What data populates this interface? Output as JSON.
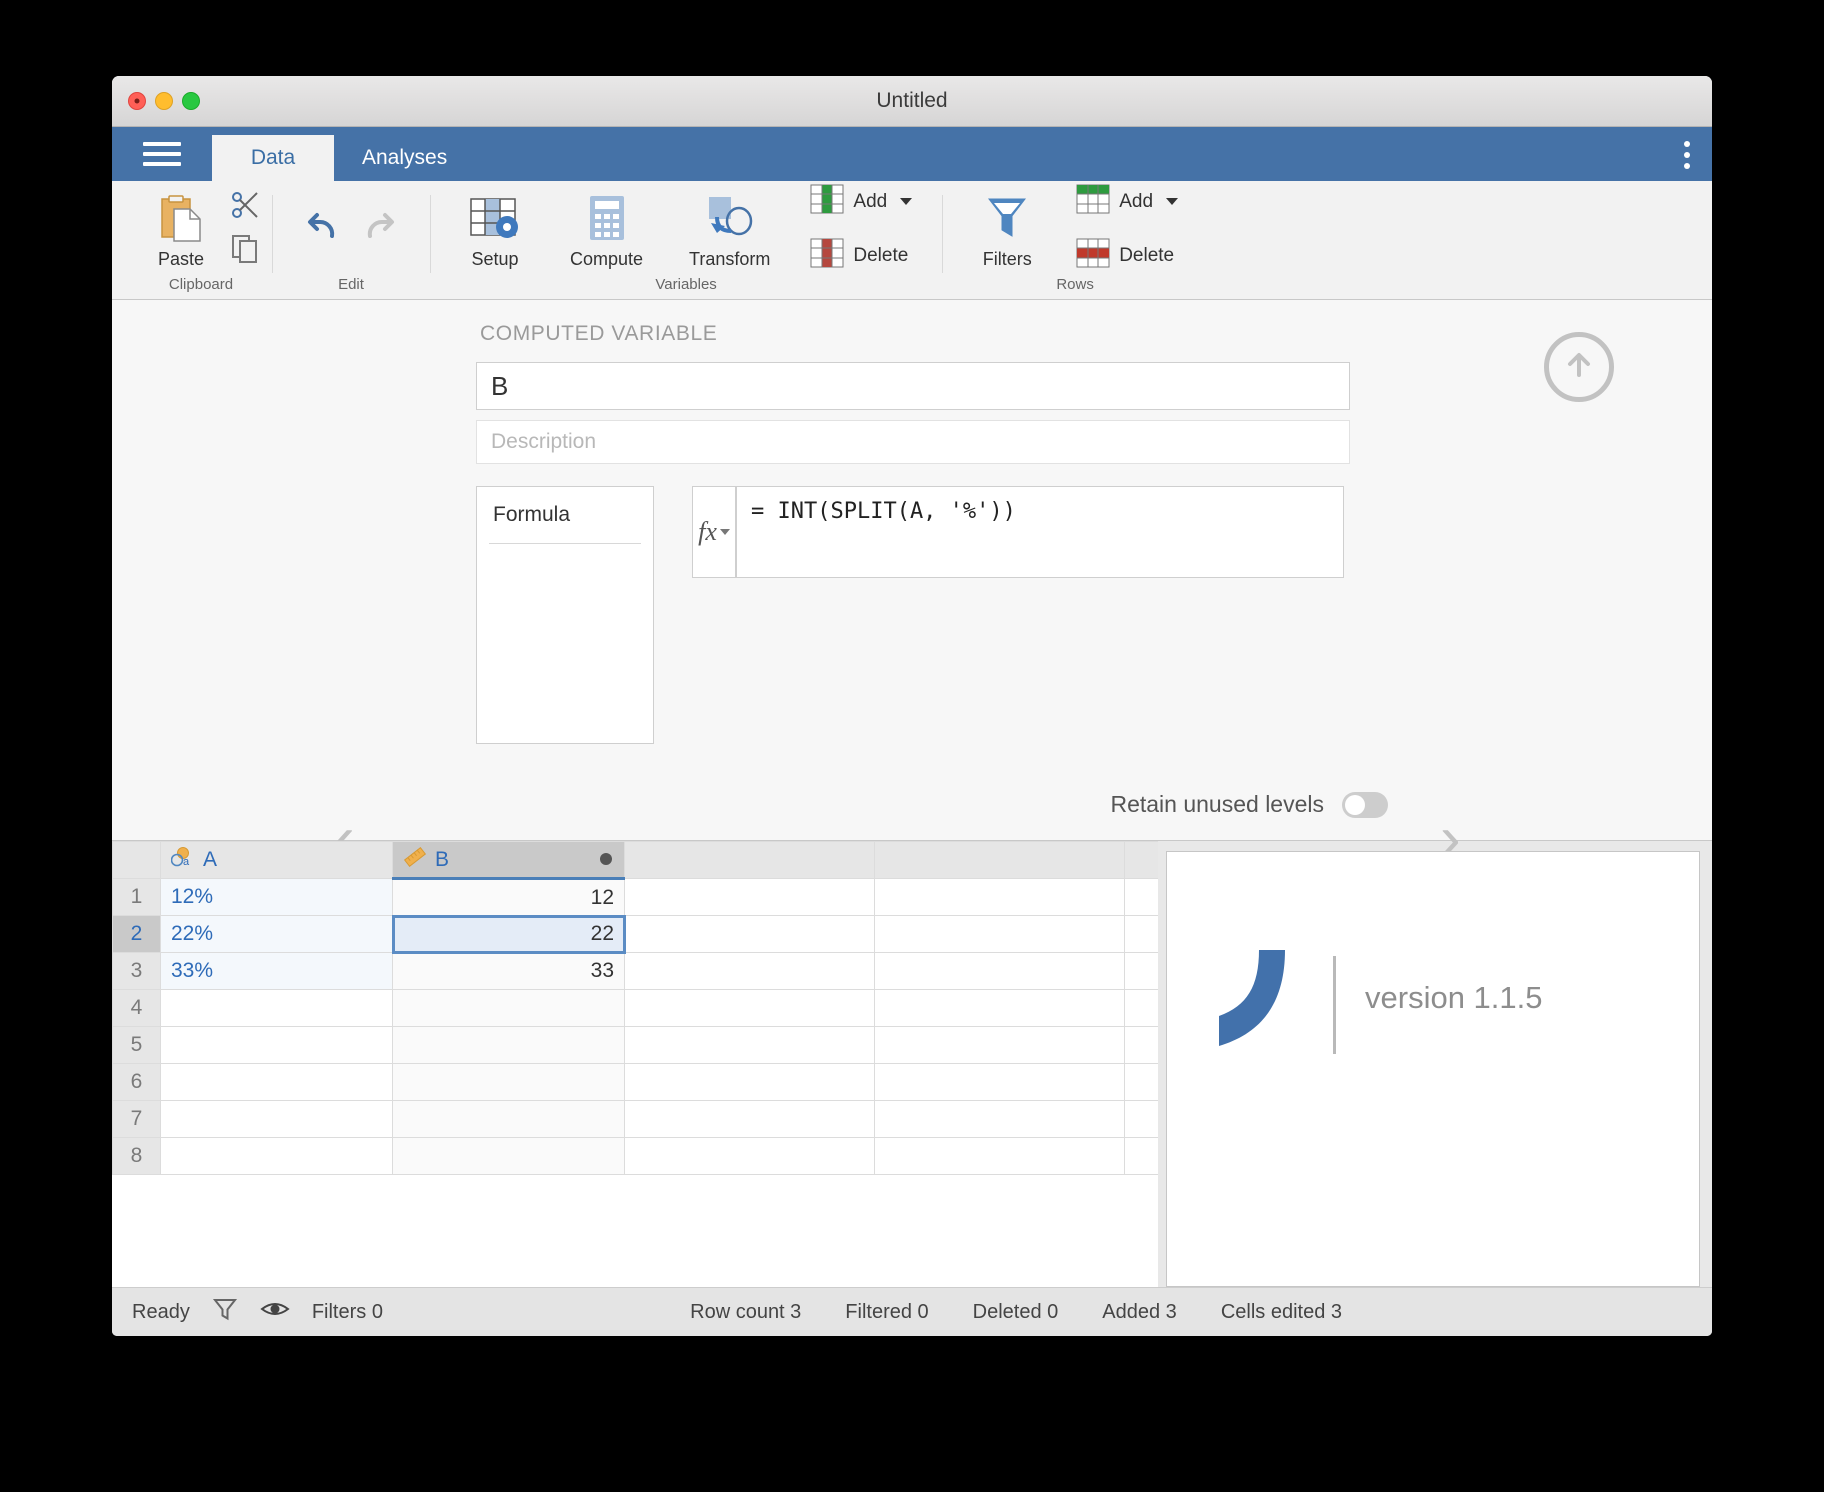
{
  "window": {
    "title": "Untitled",
    "traffic_lights": [
      "close",
      "minimize",
      "zoom"
    ]
  },
  "tabs": [
    {
      "label": "Data",
      "active": true
    },
    {
      "label": "Analyses",
      "active": false
    }
  ],
  "menu": {
    "hamburger": "hamburger-menu",
    "kebab": "more-options"
  },
  "ribbon": {
    "groups": [
      {
        "name": "Clipboard",
        "label": "Clipboard",
        "buttons": [
          {
            "label": "Paste",
            "icon": "paste-icon"
          },
          {
            "label": "Cut",
            "icon": "scissors-icon"
          },
          {
            "label": "Copy",
            "icon": "copy-icon"
          }
        ]
      },
      {
        "name": "Edit",
        "label": "Edit",
        "buttons": [
          {
            "label": "Undo",
            "icon": "undo-icon"
          },
          {
            "label": "Redo",
            "icon": "redo-icon"
          }
        ]
      },
      {
        "name": "Variables",
        "label": "Variables",
        "buttons": [
          {
            "label": "Setup",
            "icon": "setup-icon"
          },
          {
            "label": "Compute",
            "icon": "compute-icon"
          },
          {
            "label": "Transform",
            "icon": "transform-icon"
          },
          {
            "label": "Add",
            "icon": "add-variable-icon"
          },
          {
            "label": "Delete",
            "icon": "delete-variable-icon"
          }
        ]
      },
      {
        "name": "Rows",
        "label": "Rows",
        "buttons": [
          {
            "label": "Filters",
            "icon": "filter-icon"
          },
          {
            "label": "Add",
            "icon": "add-row-icon"
          },
          {
            "label": "Delete",
            "icon": "delete-row-icon"
          }
        ]
      }
    ]
  },
  "editor": {
    "heading": "COMPUTED VARIABLE",
    "name_value": "B",
    "description_placeholder": "Description",
    "formula_list": [
      "Formula"
    ],
    "fx_label": "fx",
    "formula_value": "= INT(SPLIT(A, '%'))",
    "retain_label": "Retain unused levels",
    "retain_enabled": false,
    "nav_prev": "‹",
    "nav_next": "›",
    "collapse_icon": "arrow-up-circle-icon"
  },
  "sheet": {
    "columns": [
      {
        "name": "A",
        "icon": "nominal-text-icon",
        "selected": false
      },
      {
        "name": "B",
        "icon": "continuous-ruler-icon",
        "selected": true,
        "badge": true
      },
      {
        "name": "",
        "icon": "",
        "selected": false
      },
      {
        "name": "",
        "icon": "",
        "selected": false
      },
      {
        "name": "",
        "icon": "",
        "selected": false
      }
    ],
    "rows": [
      {
        "number": "1",
        "active": false,
        "A": "12%",
        "B": "12",
        "selected_cell": null
      },
      {
        "number": "2",
        "active": true,
        "A": "22%",
        "B": "22",
        "selected_cell": "B"
      },
      {
        "number": "3",
        "active": false,
        "A": "33%",
        "B": "33",
        "selected_cell": null
      },
      {
        "number": "4",
        "active": false,
        "A": "",
        "B": "",
        "selected_cell": null
      },
      {
        "number": "5",
        "active": false,
        "A": "",
        "B": "",
        "selected_cell": null
      },
      {
        "number": "6",
        "active": false,
        "A": "",
        "B": "",
        "selected_cell": null
      },
      {
        "number": "7",
        "active": false,
        "A": "",
        "B": "",
        "selected_cell": null
      },
      {
        "number": "8",
        "active": false,
        "A": "",
        "B": "",
        "selected_cell": null
      }
    ]
  },
  "version_panel": {
    "text": "version 1.1.5",
    "logo": "jamovi-arc-logo"
  },
  "status": {
    "state": "Ready",
    "filter_icon": "funnel-icon",
    "eye_icon": "eye-icon",
    "filters": "Filters 0",
    "row_count": "Row count 3",
    "filtered": "Filtered 0",
    "deleted": "Deleted 0",
    "added": "Added 3",
    "cells_edited": "Cells edited 3"
  },
  "colors": {
    "accent": "#4572a7",
    "tab_active_text": "#3a6ea5",
    "cell_text_blue": "#2e6bb8",
    "selection_border": "#5b8cc4"
  }
}
